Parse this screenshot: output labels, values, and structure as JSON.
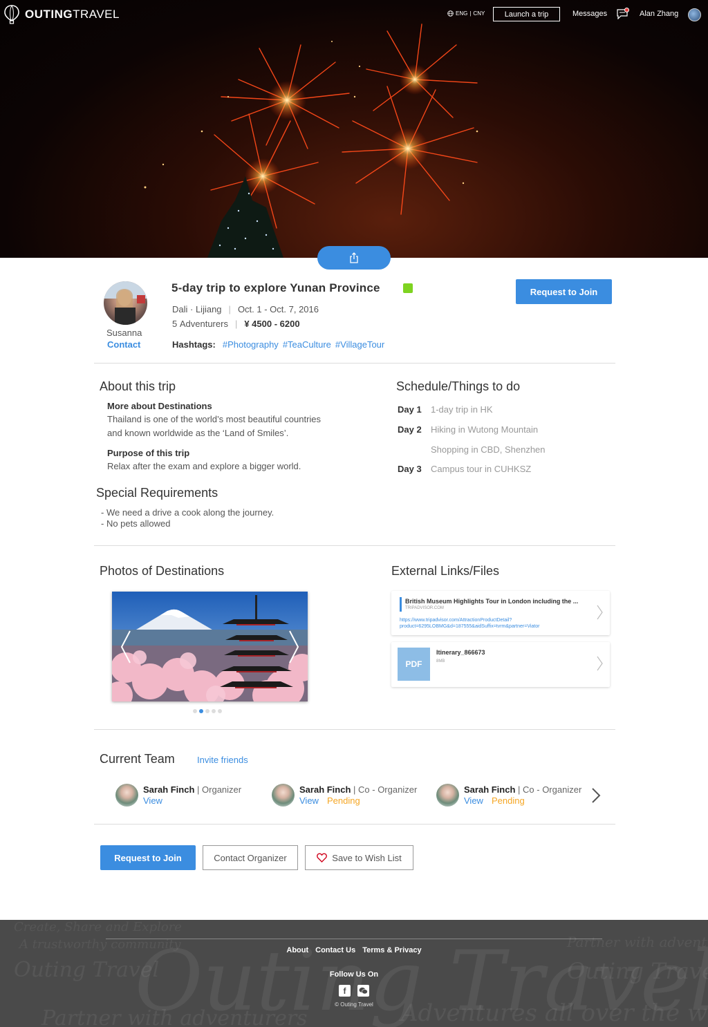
{
  "brand": {
    "name_bold": "OUTING",
    "name_light": "TRAVEL"
  },
  "topbar": {
    "lang_eng": "ENG",
    "lang_cny": "CNY",
    "launch_label": "Launch a trip",
    "messages_label": "Messages",
    "user_name": "Alan Zhang"
  },
  "trip": {
    "organizer_name": "Susanna",
    "contact_label": "Contact",
    "title": "5-day trip to explore Yunan Province",
    "route": "Dali · Lijiang",
    "dates": "Oct. 1  -  Oct. 7, 2016",
    "adventurers_count": "5",
    "adventurers_label": "Adventurers",
    "price": "¥ 4500 - 6200",
    "hashtags_label": "Hashtags:",
    "hashtags": [
      "#Photography",
      "#TeaCulture",
      "#VillageTour"
    ],
    "join_label": "Request to Join",
    "status_color": "#7ed321"
  },
  "about": {
    "heading": "About this trip",
    "dest_heading": "More about Destinations",
    "dest_line1": "Thailand is one of the world’s most beautiful countries",
    "dest_line2": "and known worldwide as the ‘Land of Smiles’.",
    "purpose_heading": "Purpose of this trip",
    "purpose_text": "Relax after the exam and explore a bigger world."
  },
  "requirements": {
    "heading": "Special Requirements",
    "items": [
      "- We need a drive a cook along the journey.",
      "- No pets allowed"
    ]
  },
  "schedule": {
    "heading": "Schedule/Things to do",
    "rows": [
      {
        "day": "Day 1",
        "activity": "1-day trip in HK"
      },
      {
        "day": "Day 2",
        "activity": "Hiking in Wutong Mountain"
      },
      {
        "day": "",
        "activity": "Shopping in CBD, Shenzhen"
      },
      {
        "day": "Day 3",
        "activity": "Campus tour in CUHKSZ"
      }
    ]
  },
  "photos": {
    "heading": "Photos of Destinations",
    "active_index": 1,
    "count": 5
  },
  "links": {
    "heading": "External Links/Files",
    "link_title": "British Museum Highlights Tour in London including the ...",
    "link_source": "TRIPADVISOR.COM",
    "link_url_1": "https://www.tripadvisor.com/AttractionProductDetail?",
    "link_url_2": "product=6295LOBMG&d=187555&aidSuffix=tvrm&partner=Viator",
    "file_type": "PDF",
    "file_name": "Itinerary_866673",
    "file_size": "8MB"
  },
  "team": {
    "heading": "Current Team",
    "invite_label": "Invite friends",
    "members": [
      {
        "name": "Sarah Finch",
        "role": " | Organizer",
        "view": "View",
        "pending": ""
      },
      {
        "name": "Sarah Finch",
        "role": " | Co - Organizer",
        "view": "View",
        "pending": "Pending"
      },
      {
        "name": "Sarah Finch",
        "role": " | Co - Organizer",
        "view": "View",
        "pending": "Pending"
      }
    ]
  },
  "actions": {
    "join_label": "Request to Join",
    "contact_label": "Contact Organizer",
    "wish_label": "Save to Wish List"
  },
  "footer": {
    "links": [
      "About",
      "Contact Us",
      "Terms & Privacy"
    ],
    "follow_label": "Follow Us On",
    "copyright": "© Outing Travel",
    "bg_text_1": "Outing Travel",
    "bg_text_2": "Adventures all over the world",
    "bg_text_3": "Partner with adventurers",
    "bg_text_4": "Create, Share and Explore",
    "bg_text_5": "A trustworthy community"
  },
  "colors": {
    "accent": "#3b8de0",
    "pending": "#f5a623",
    "footer_bg": "#4a4a4a"
  },
  "icons": [
    "balloon-logo-icon",
    "globe-icon",
    "message-icon",
    "share-icon",
    "chevron-left-icon",
    "chevron-right-icon",
    "heart-icon",
    "facebook-icon",
    "wechat-icon"
  ]
}
